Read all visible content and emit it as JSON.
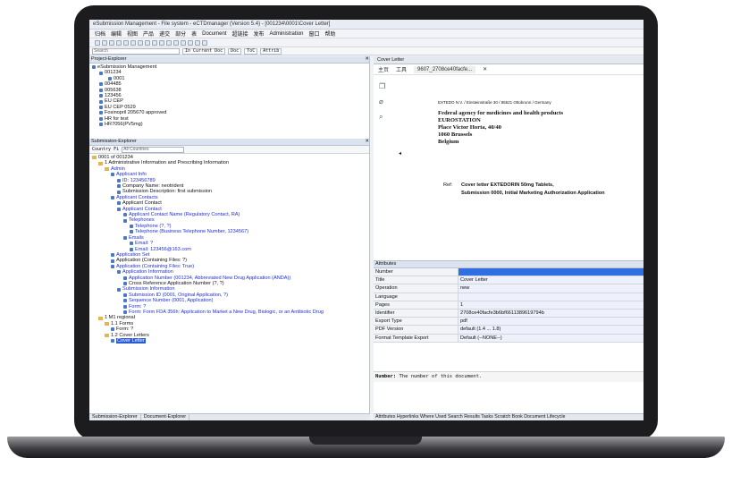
{
  "window": {
    "title": "eSubmission Management - File system - eCTDmanager (Version 5.4) - [001234\\0001\\Cover Letter]"
  },
  "menu": [
    "归档",
    "编辑",
    "视图",
    "产品",
    "递交",
    "部分",
    "表",
    "Document",
    "超链接",
    "发布",
    "Administration",
    "窗口",
    "帮助"
  ],
  "toolbar": {
    "search_placeholder": "Search",
    "current_doc": "In Current Doc",
    "doc_chip": "Doc",
    "toc_chip": "ToC",
    "attrib_chip": "Attrib"
  },
  "project_explorer": {
    "title": "Project-Explorer",
    "root": "eSubmission Management",
    "items": [
      "001234",
      "0001",
      "004485",
      "005638",
      "123456",
      "EU CEP",
      "EU CEP 0529",
      "Fosinopril 205670 approved",
      "HR for test",
      "HR7056(PV5mg)"
    ]
  },
  "submission_explorer": {
    "title": "Submission-Explorer",
    "country_label": "Country Fi",
    "country_value": "All Countries",
    "tree": [
      {
        "t": "0001 of 001234",
        "i": 0,
        "c": ""
      },
      {
        "t": "1 Administrative Information and Prescribing Information",
        "i": 1,
        "c": ""
      },
      {
        "t": "Admin",
        "i": 2,
        "c": "blue"
      },
      {
        "t": "Applicant Info",
        "i": 3,
        "c": "blue"
      },
      {
        "t": "ID: 123456789",
        "i": 4,
        "c": "blue"
      },
      {
        "t": "Company Name: neotrident",
        "i": 4,
        "c": ""
      },
      {
        "t": "Submission Description: first submission",
        "i": 4,
        "c": ""
      },
      {
        "t": "Applicant Contacts",
        "i": 3,
        "c": "blue"
      },
      {
        "t": "Applicant Contact",
        "i": 4,
        "c": ""
      },
      {
        "t": "Applicant Contact",
        "i": 4,
        "c": "blue"
      },
      {
        "t": "Applicant Contact Name (Regulatory Contact, RA)",
        "i": 5,
        "c": "blue"
      },
      {
        "t": "Telephones",
        "i": 5,
        "c": "blue"
      },
      {
        "t": "Telephone (?, ?)",
        "i": 6,
        "c": "blue"
      },
      {
        "t": "Telephone (Business Telephone Number, 1234567)",
        "i": 6,
        "c": "blue"
      },
      {
        "t": "Emails",
        "i": 5,
        "c": "blue"
      },
      {
        "t": "Email: ?",
        "i": 6,
        "c": "blue"
      },
      {
        "t": "Email: 123456@163.com",
        "i": 6,
        "c": "blue"
      },
      {
        "t": "Application Set",
        "i": 3,
        "c": "blue"
      },
      {
        "t": "Application (Containing Files: ?)",
        "i": 3,
        "c": ""
      },
      {
        "t": "Application (Containing Files: True)",
        "i": 3,
        "c": "blue"
      },
      {
        "t": "Application Information",
        "i": 4,
        "c": "blue"
      },
      {
        "t": "Application Number (001234, Abbreviated New Drug Application (ANDA))",
        "i": 5,
        "c": "blue"
      },
      {
        "t": "Cross Reference Application Number (?, ?)",
        "i": 5,
        "c": ""
      },
      {
        "t": "Submission Information",
        "i": 4,
        "c": "blue"
      },
      {
        "t": "Submission ID (0001, Original Application, ?)",
        "i": 5,
        "c": "blue"
      },
      {
        "t": "Sequence Number (0001, Application)",
        "i": 5,
        "c": "blue"
      },
      {
        "t": "Form: ?",
        "i": 5,
        "c": "blue"
      },
      {
        "t": "Form: Form FDA 356h: Application to Market a New Drug, Biologic, or an Antibiotic Drug",
        "i": 5,
        "c": "blue"
      },
      {
        "t": "1 M1 regional",
        "i": 1,
        "c": ""
      },
      {
        "t": "1.1 Forms",
        "i": 2,
        "c": ""
      },
      {
        "t": "Form: ?",
        "i": 3,
        "c": ""
      },
      {
        "t": "1.2 Cover Letters",
        "i": 2,
        "c": ""
      },
      {
        "t": "Cover Letter",
        "i": 3,
        "c": "sel"
      }
    ]
  },
  "left_tabs": [
    "Submission-Explorer",
    "Document-Explorer"
  ],
  "document": {
    "tab": "Cover Letter",
    "viewer_tab1": "主页",
    "viewer_tab2": "工具",
    "file_tab": "9607_2708ce40facfe...",
    "address": "EXTEDO N.V. / Einsteinstraße 30 / 85521 Ottobrunn / Germany",
    "recipient": [
      "Federal agency for medicines and health products",
      "EUROSTATION",
      "Place Victor Horta, 40/40",
      "1060 Brussels",
      "Belgium"
    ],
    "ref_label": "Ref:",
    "ref_text": [
      "Cover letter EXTEDORIN 50mg Tablets,",
      "Submission 0000, Initial Marketing Authorization Application"
    ]
  },
  "attributes": {
    "title": "Attributes",
    "rows": [
      {
        "k": "Number",
        "v": ""
      },
      {
        "k": "Title",
        "v": "Cover Letter"
      },
      {
        "k": "Operation",
        "v": "new"
      },
      {
        "k": "Language",
        "v": ""
      },
      {
        "k": "Pages",
        "v": "1"
      },
      {
        "k": "Identifier",
        "v": "2708ce40facfe3b6bf6611389619794b"
      },
      {
        "k": "Export Type",
        "v": "pdf"
      },
      {
        "k": "PDF Version",
        "v": "default (1.4 ... 1.8)"
      },
      {
        "k": "Format Template Export",
        "v": "Default (--NONE--)"
      }
    ],
    "desc_label": "Number:",
    "desc_text": "The number of this document."
  },
  "bottom_tabs": "Attributes  Hyperlinks  Where Used  Search Results  Tasks  Scratch Book  Document Lifecycle"
}
